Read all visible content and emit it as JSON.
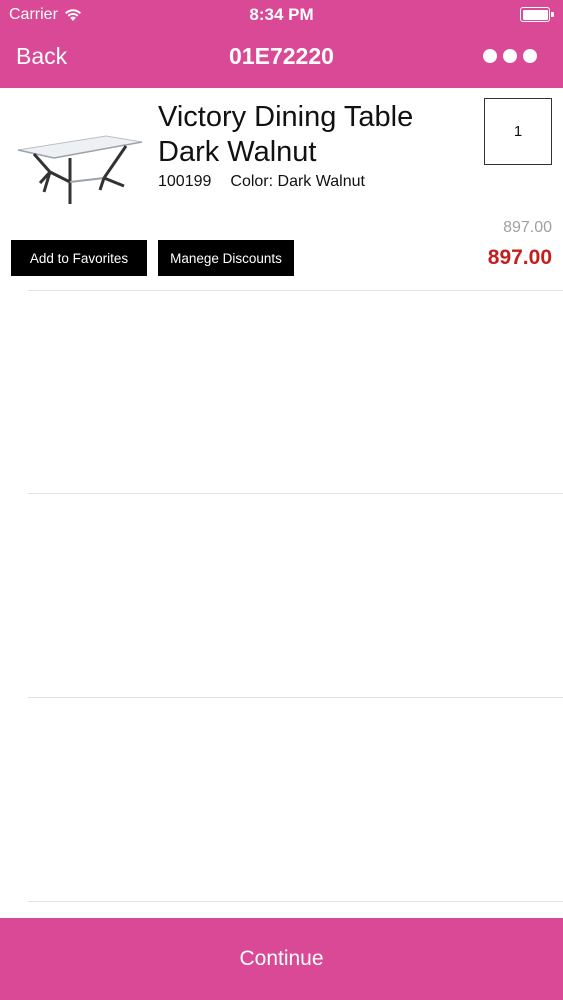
{
  "status_bar": {
    "carrier": "Carrier",
    "time": "8:34 PM"
  },
  "nav": {
    "back_label": "Back",
    "title": "01E72220",
    "more_icon": "ellipsis-icon"
  },
  "cart_item": {
    "name_line1": "Victory Dining Table",
    "name_line2": "Dark Walnut",
    "sku": "100199",
    "color_label": "Color: Dark Walnut",
    "quantity": "1",
    "original_price": "897.00",
    "final_price": "897.00",
    "add_favorites_label": "Add to Favorites",
    "manage_discounts_label": "Manege Discounts"
  },
  "footer": {
    "continue_label": "Continue"
  },
  "colors": {
    "brand": "#d94995",
    "price_red": "#c41e1e",
    "button_bg": "#000000"
  }
}
